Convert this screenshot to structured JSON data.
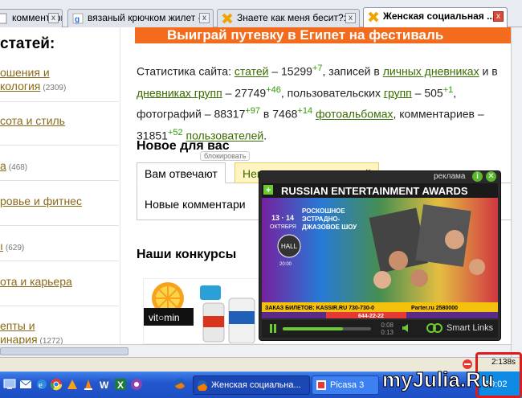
{
  "browser": {
    "tabs": [
      {
        "title": "комментари...",
        "icon": "page-icon",
        "active": false
      },
      {
        "title": "вязаный крючком жилет -...",
        "icon": "google-icon",
        "active": false
      },
      {
        "title": "Знаете как меня бесит?:...",
        "icon": "liru-icon",
        "active": false
      },
      {
        "title": "Женская социальная ...",
        "icon": "liru-icon",
        "active": true
      }
    ]
  },
  "sidebar": {
    "title": "статей:",
    "items": [
      {
        "line1": "ошения и",
        "line2": "кология",
        "count": "(2309)"
      },
      {
        "line1": "сота и стиль",
        "line2": "",
        "count": ""
      },
      {
        "line1": "а",
        "line2": "",
        "count": "(468)"
      },
      {
        "line1": "ровье и фитнес",
        "line2": "",
        "count": ""
      },
      {
        "line1": "ı",
        "line2": "",
        "count": "(629)"
      },
      {
        "line1": "ота и карьера",
        "line2": "",
        "count": ""
      },
      {
        "line1": "епты и",
        "line2": "инария",
        "count": "(1272)"
      }
    ]
  },
  "main": {
    "banner": "Выиграй путевку в Египет на фестиваль",
    "stats": {
      "p1": "Статистика сайта: ",
      "articles_link": "статей",
      "p2": " – 15299",
      "articles_delta": "+7",
      "p3": ", записей в ",
      "diaries_link": "личных дневниках",
      "p4": " и в ",
      "groups_diaries_link": "дневниках групп",
      "p5": " – 27749",
      "diaries_delta": "+46",
      "p6": ", пользовательских ",
      "groups_link": "групп",
      "p7": " – 505",
      "groups_delta": "+1",
      "p8": ", фотографий – 88317",
      "photos_delta": "+97",
      "p9": " в 7468",
      "albums_delta": "+14",
      "p10": " ",
      "albums_link": "фотоальбомах",
      "p11": ", комментариев – 31851",
      "comments_delta": "+52",
      "p12": " ",
      "users_link": "пользователей",
      "p13": "."
    },
    "new_for_you_title": "Новое для вас",
    "block_label": "блокировать",
    "tabs": [
      "Вам отвечают",
      "Непрочитанное у друзей"
    ],
    "new_comments": "Новые комментари",
    "contests_title": "Наши конкурсы",
    "vitamin_brand": "vit○min"
  },
  "ad": {
    "label": "реклама",
    "info_glyph": "i",
    "close_glyph": "✕",
    "headline": "RUSSIAN ENTERTAINMENT AWARDS",
    "subtitle": "РОСКОШНОЕ ЭСТРАДНО-ДЖАЗОВОЕ ШОУ",
    "date": "13 · 14",
    "month": "ОКТЯБРЯ",
    "hall": "HALL",
    "time": "20:00",
    "tickets": "ЗАКАЗ БИЛЕТОВ: KASSIR.RU 730-730-0",
    "partner": "Parter.ru 2580000",
    "phone": "644-22-22",
    "elapsed": "0:08",
    "total": "0:13",
    "progress": 0.68,
    "smart_links": "Smart Links"
  },
  "statusbar": {
    "time": "2:138s"
  },
  "taskbar": {
    "buttons": [
      {
        "label": "Женская социальна...",
        "active": true
      },
      {
        "label": "Picasa 3",
        "active": false
      }
    ],
    "clock": "19:02",
    "quicklaunch": [
      "display-icon",
      "email-icon",
      "ie-icon",
      "chrome-icon",
      "winamp-icon",
      "vlc-icon",
      "word-icon",
      "excel-icon",
      "picasa-icon",
      "firefox-icon"
    ]
  },
  "watermark": "myJulia.Ru",
  "colors": {
    "link": "#3a6b00",
    "delta": "#2e9b00",
    "sidebar_link": "#8a6a1a",
    "banner": "#f36b1c",
    "taskbar": "#2457cf"
  }
}
